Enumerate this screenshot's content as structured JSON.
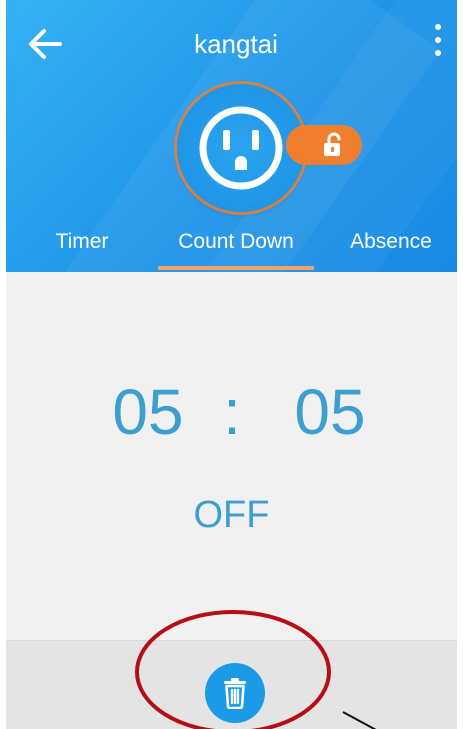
{
  "header": {
    "title": "kangtai",
    "back_icon": "back-arrow-icon",
    "more_icon": "more-vertical-icon",
    "background_color": "#1f94e8"
  },
  "device": {
    "icon": "power-outlet-icon",
    "lock_icon": "unlocked-padlock-icon",
    "lock_color": "#ef7f2e"
  },
  "tabs": [
    {
      "label": "Timer",
      "active": false
    },
    {
      "label": "Count Down",
      "active": true
    },
    {
      "label": "Absence",
      "active": false
    }
  ],
  "countdown": {
    "hours": "05",
    "separator": ":",
    "minutes": "05",
    "state": "OFF",
    "text_color": "#3d9fd0"
  },
  "footer": {
    "delete_icon": "trash-icon",
    "button_color": "#1b9be6"
  },
  "annotation": {
    "type": "red-ellipse-highlight",
    "color": "#b50f16"
  }
}
